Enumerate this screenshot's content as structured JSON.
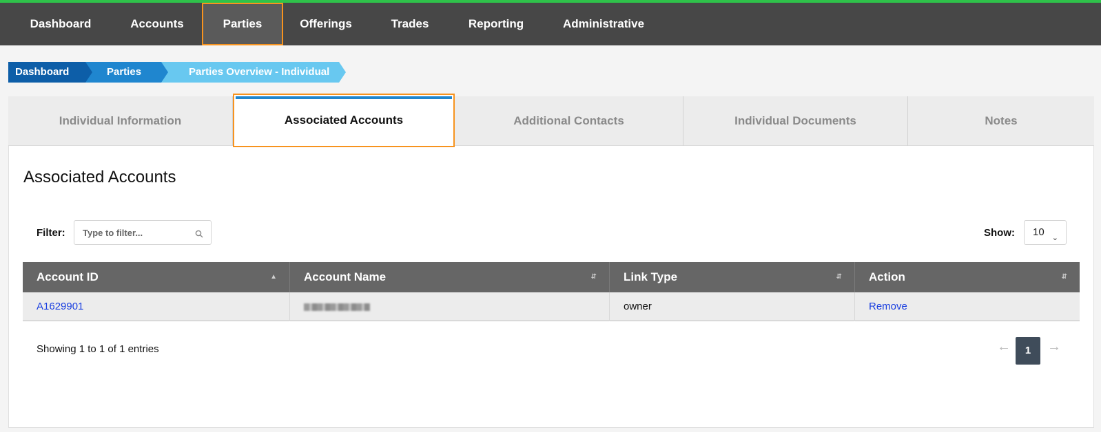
{
  "nav": {
    "items": [
      {
        "label": "Dashboard"
      },
      {
        "label": "Accounts"
      },
      {
        "label": "Parties"
      },
      {
        "label": "Offerings"
      },
      {
        "label": "Trades"
      },
      {
        "label": "Reporting"
      },
      {
        "label": "Administrative"
      }
    ],
    "active": "Parties"
  },
  "breadcrumb": [
    "Dashboard",
    "Parties",
    "Parties Overview - Individual"
  ],
  "tabs": [
    {
      "label": "Individual Information"
    },
    {
      "label": "Associated Accounts"
    },
    {
      "label": "Additional Contacts"
    },
    {
      "label": "Individual Documents"
    },
    {
      "label": "Notes"
    }
  ],
  "section_title": "Associated Accounts",
  "filter": {
    "label": "Filter:",
    "placeholder": "Type to filter..."
  },
  "show": {
    "label": "Show:",
    "value": "10"
  },
  "table": {
    "headers": [
      "Account ID",
      "Account Name",
      "Link Type",
      "Action"
    ],
    "rows": [
      {
        "account_id": "A1629901",
        "link_type": "owner",
        "action": "Remove"
      }
    ]
  },
  "footer": {
    "showing": "Showing 1 to 1 of 1 entries",
    "page": "1",
    "prev": "←",
    "next": "→"
  },
  "colors": {
    "accent_highlight": "#f7931e",
    "nav_bg": "#474747",
    "link": "#1a3fe0",
    "top_stripe": "#2fc24a"
  }
}
